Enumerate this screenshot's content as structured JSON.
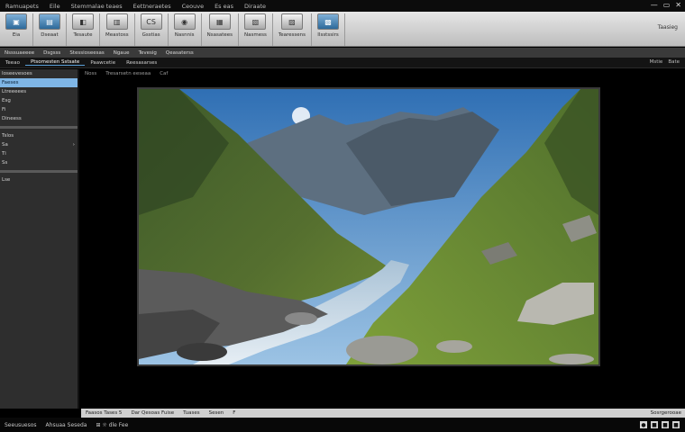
{
  "menu": [
    "Ramuapets",
    "Eile",
    "Stemmalae teaes",
    "Eettneraetes",
    "Ceouve",
    "Es eas",
    "Diraate"
  ],
  "window_controls": [
    "—",
    "▭",
    "✕"
  ],
  "ribbon": {
    "groups": [
      {
        "icon": "▣",
        "label": "Eia"
      },
      {
        "icon": "▤",
        "label": "Dseaat"
      },
      {
        "icon": "◧",
        "label": "Tesaute"
      },
      {
        "icon": "▥",
        "label": "Meastoss"
      },
      {
        "icon": "CS",
        "label": "Gsstias"
      },
      {
        "icon": "◉",
        "label": "Nasnnis"
      },
      {
        "icon": "▦",
        "label": "Nsasatees"
      },
      {
        "icon": "▧",
        "label": "Nasmess"
      },
      {
        "icon": "▨",
        "label": "Tearessens"
      },
      {
        "icon": "▩",
        "label": "Ilsstssirs"
      }
    ],
    "title": "Taasieg"
  },
  "subbar": [
    "Nsssuaeeee",
    "Dsgsss",
    "Stessioseesas",
    "Ngaue",
    "Tevesig",
    "Qeasaterss"
  ],
  "tabs": [
    "Teeao",
    "Ptsomesten Sstsate",
    "Paawcetie",
    "Reesasarses"
  ],
  "tabs_right": [
    "Mstie",
    "Bate"
  ],
  "left_panel": {
    "rows": [
      "Ioseevesoes",
      "Faeses",
      "Ltreeeees",
      "Esg",
      "Fi",
      "Dineess",
      "Tslos",
      "Sa",
      "Ti",
      "Ss",
      "Lse"
    ]
  },
  "viewport": {
    "caption": [
      "Noss",
      "Tresarsetn eeseaa",
      "Caf"
    ]
  },
  "timeline": {
    "items": [
      "Faasos Tases 5",
      "Dar Qesoas Fuise",
      "Tuases",
      "Sesen",
      "F"
    ],
    "right": "Sosrgerooae"
  },
  "status": {
    "items": [
      "Seeusuesos",
      "Ahsuaa Seseda",
      "⊞ ☼ dle Fee"
    ],
    "right": [
      "●",
      "■",
      "■",
      "■"
    ]
  }
}
